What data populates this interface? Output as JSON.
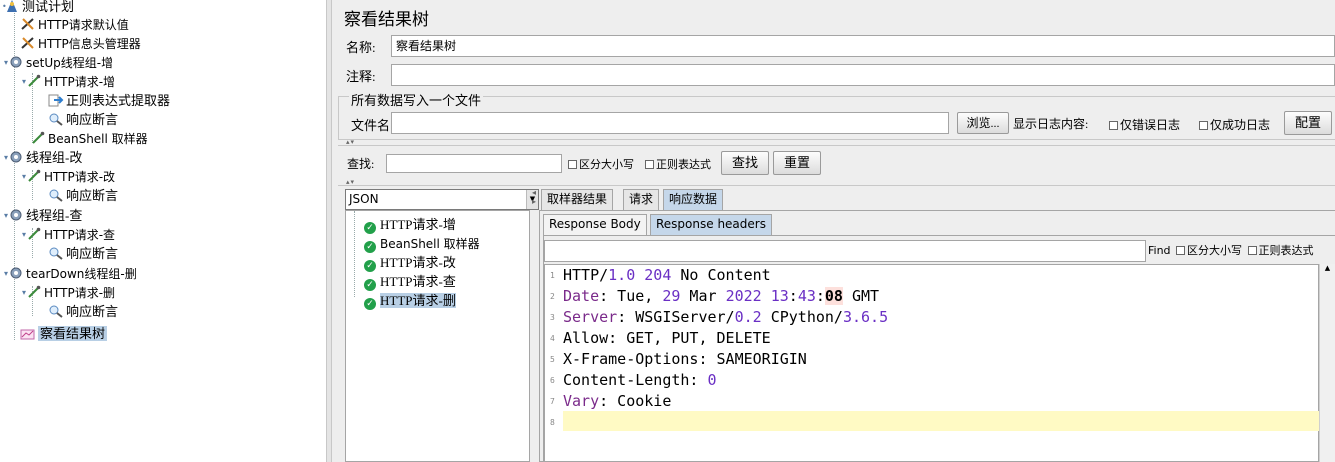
{
  "tree": {
    "items": [
      {
        "label": "测试计划",
        "icon": "test-plan-icon"
      },
      {
        "label": "HTTP请求默认值",
        "icon": "wrench-icon"
      },
      {
        "label": "HTTP信息头管理器",
        "icon": "wrench-icon"
      },
      {
        "label": "setUp线程组-增",
        "icon": "gear-icon"
      },
      {
        "label": "HTTP请求-增",
        "icon": "pipette-icon"
      },
      {
        "label": "正则表达式提取器",
        "icon": "arrow-icon"
      },
      {
        "label": "响应断言",
        "icon": "magnifier-icon"
      },
      {
        "label": "BeanShell 取样器",
        "icon": "pipette-icon"
      },
      {
        "label": "线程组-改",
        "icon": "gear-icon"
      },
      {
        "label": "HTTP请求-改",
        "icon": "pipette-icon"
      },
      {
        "label": "响应断言",
        "icon": "magnifier-icon"
      },
      {
        "label": "线程组-查",
        "icon": "gear-icon"
      },
      {
        "label": "HTTP请求-查",
        "icon": "pipette-icon"
      },
      {
        "label": "响应断言",
        "icon": "magnifier-icon"
      },
      {
        "label": "tearDown线程组-删",
        "icon": "gear-icon"
      },
      {
        "label": "HTTP请求-删",
        "icon": "pipette-icon"
      },
      {
        "label": "响应断言",
        "icon": "magnifier-icon"
      },
      {
        "label": "察看结果树",
        "icon": "graph-icon"
      }
    ]
  },
  "panel": {
    "title": "察看结果树",
    "name_label": "名称:",
    "name_value": "察看结果树",
    "comment_label": "注释:",
    "comment_value": "",
    "fieldset_legend": "所有数据写入一个文件",
    "filename_label": "文件名",
    "filename_value": "",
    "browse_label": "浏览...",
    "log_content_label": "显示日志内容:",
    "errors_only_label": "仅错误日志",
    "success_only_label": "仅成功日志",
    "config_label": "配置"
  },
  "search": {
    "label": "查找:",
    "value": "",
    "case_label": "区分大小写",
    "regex_label": "正则表达式",
    "find_label": "查找",
    "reset_label": "重置"
  },
  "results": {
    "renderer": "JSON",
    "items": [
      "HTTP请求-增",
      "BeanShell 取样器",
      "HTTP请求-改",
      "HTTP请求-查",
      "HTTP请求-删"
    ],
    "selected": "HTTP请求-删"
  },
  "tabs": [
    "取样器结果",
    "请求",
    "响应数据"
  ],
  "active_tab": "响应数据",
  "subtabs": [
    "Response Body",
    "Response headers"
  ],
  "active_subtab": "Response headers",
  "find": {
    "button": "Find",
    "case_label": "区分大小写",
    "regex_label": "正则表达式"
  },
  "headers": {
    "line1": {
      "a": "HTTP/",
      "b": "1.0",
      "c": " ",
      "d": "204",
      "e": " No Content"
    },
    "line2": {
      "a": "Date",
      "b": ": Tue, ",
      "c": "29",
      "d": " Mar ",
      "e": "2022",
      "f": " ",
      "g": "13",
      "h": ":",
      "i": "43",
      "j": ":",
      "k": "08",
      "l": " GMT"
    },
    "line3": {
      "a": "Server",
      "b": ": WSGIServer/",
      "c": "0.2",
      "d": " CPython/",
      "e": "3.6.5"
    },
    "line4": {
      "a": "Allow: GET, PUT, DELETE"
    },
    "line5": {
      "a": "X-Frame-Options: SAMEORIGIN"
    },
    "line6": {
      "a": "Content-Length: ",
      "b": "0"
    },
    "line7": {
      "a": "Vary",
      "b": ": Cookie"
    },
    "line_numbers": [
      "1",
      "2",
      "3",
      "4",
      "5",
      "6",
      "7",
      "8"
    ]
  },
  "colors": {
    "selection": "#b8cfe5",
    "active_tab": "#c5d7ea",
    "current_line": "#fffac4",
    "keyword": "#7a2a8a",
    "number": "#6a2fc4",
    "success_icon": "#22a04a"
  }
}
